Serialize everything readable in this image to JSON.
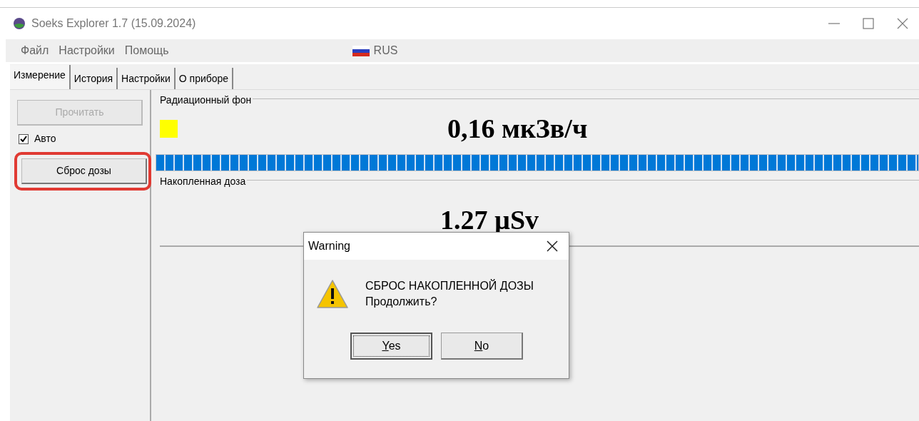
{
  "window": {
    "title": "Soeks Explorer 1.7 (15.09.2024)"
  },
  "menu": [
    "Файл",
    "Настройки",
    "Помощь"
  ],
  "language": {
    "label": "RUS"
  },
  "tabs": [
    {
      "label": "Измерение",
      "selected": true
    },
    {
      "label": "История",
      "selected": false
    },
    {
      "label": "Настройки",
      "selected": false
    },
    {
      "label": "О приборе",
      "selected": false
    }
  ],
  "controls": {
    "read_button": {
      "label": "Прочитать",
      "disabled": true
    },
    "auto": {
      "label": "Авто",
      "checked": true
    },
    "reset_button": {
      "label": "Сброс дозы",
      "highlighted": true
    }
  },
  "background": {
    "title": "Радиационный фон",
    "indicator": {
      "color": "#ffff00"
    },
    "value": "0,16 мкЗв/ч",
    "bar": {
      "level": 1
    }
  },
  "dose": {
    "title": "Накопленная доза",
    "value": "1.27 µSv"
  },
  "dialog": {
    "title": "Warning",
    "message": "СБРОС НАКОПЛЕННОЙ ДОЗЫ",
    "question": "Продолжить?",
    "buttons": [
      {
        "label": "Yes",
        "access_key": true,
        "default": true
      },
      {
        "label": "No",
        "access_key": true,
        "default": false
      }
    ]
  }
}
